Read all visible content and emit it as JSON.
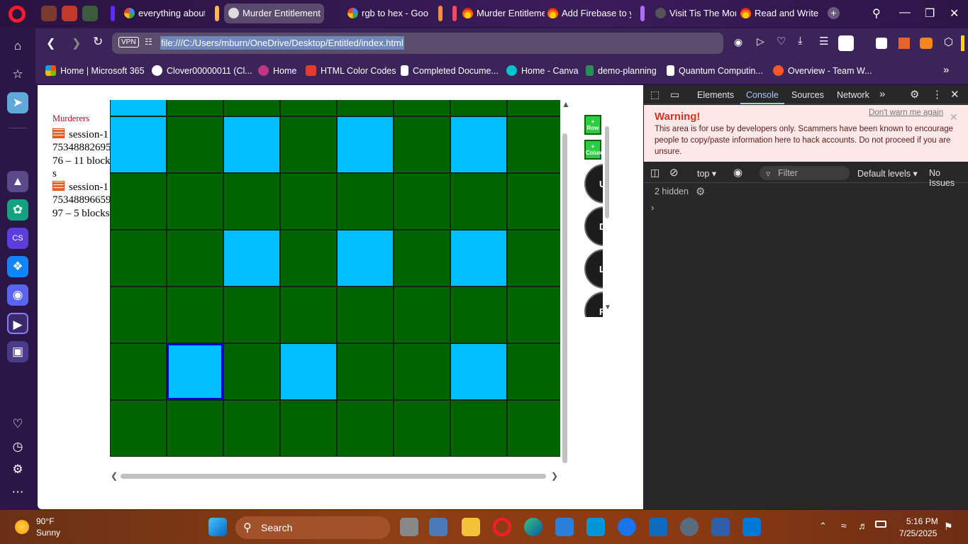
{
  "browser": {
    "tabs": [
      {
        "title": "everything about",
        "favicon": "google-icon"
      },
      {
        "title": "Murder Entitlement",
        "favicon": "globe-icon",
        "active": true
      },
      {
        "title": "rgb to hex - Goo",
        "favicon": "google-icon"
      },
      {
        "title": "Murder Entitleme",
        "favicon": "firebase-icon"
      },
      {
        "title": "Add Firebase to y",
        "favicon": "firebase-icon"
      },
      {
        "title": "Visit Tis The Mor",
        "favicon": "site-icon"
      },
      {
        "title": "Read and Write D",
        "favicon": "firebase-icon"
      }
    ],
    "vpn_label": "VPN",
    "url": "file:///C:/Users/mburn/OneDrive/Desktop/Entitled/index.html",
    "bookmarks": [
      {
        "label": "Home | Microsoft 365",
        "color": "#f25022"
      },
      {
        "label": "Clover00000011 (Cl...",
        "color": "#ffffff"
      },
      {
        "label": "Home",
        "color": "#c13584"
      },
      {
        "label": "HTML Color Codes",
        "color": "#e33b2e"
      },
      {
        "label": "Completed Docume...",
        "color": "#ffffff"
      },
      {
        "label": "Home - Canva",
        "color": "#00c4cc"
      },
      {
        "label": "demo-planning",
        "color": "#2e8b57"
      },
      {
        "label": "Quantum Computin...",
        "color": "#ffffff"
      },
      {
        "label": "Overview - Team W...",
        "color": "#ff5722"
      }
    ]
  },
  "app": {
    "murderers_title": "Murderers",
    "murderers": [
      {
        "text": "session-17534888269576 – 11 blocks"
      },
      {
        "text": "session-17534889665997 – 5 blocks"
      }
    ],
    "grid_columns": 8,
    "grid_rows": [
      [
        "b",
        "g",
        "g",
        "g",
        "g",
        "g",
        "g",
        "g"
      ],
      [
        "b",
        "g",
        "b",
        "g",
        "b",
        "g",
        "b",
        "g"
      ],
      [
        "g",
        "g",
        "g",
        "g",
        "g",
        "g",
        "g",
        "g"
      ],
      [
        "g",
        "g",
        "b",
        "g",
        "b",
        "g",
        "b",
        "g"
      ],
      [
        "g",
        "g",
        "g",
        "g",
        "g",
        "g",
        "g",
        "g"
      ],
      [
        "g",
        "b",
        "g",
        "b",
        "g",
        "g",
        "b",
        "g"
      ],
      [
        "g",
        "g",
        "g",
        "g",
        "g",
        "g",
        "g",
        "g"
      ]
    ],
    "selected_cell": {
      "row": 5,
      "col": 1
    },
    "colors": {
      "green": "#006400",
      "blue": "#00bfff",
      "selected_border": "#0000cd"
    },
    "add_row_label": "+ Row",
    "add_column_label": "+ Column",
    "direction_buttons": [
      "Up",
      "Down",
      "Left",
      "Right"
    ]
  },
  "devtools": {
    "tabs": [
      "Elements",
      "Console",
      "Sources",
      "Network"
    ],
    "active_tab": "Console",
    "warning_title": "Warning!",
    "warning_text": "This area is for use by developers only. Scammers have been known to encourage people to copy/paste information here to hack accounts. Do not proceed if you are unsure.",
    "dont_warn": "Don't warn me again",
    "context": "top",
    "filter_placeholder": "Filter",
    "levels": "Default levels",
    "issues": "No Issues",
    "hidden": "2 hidden"
  },
  "taskbar": {
    "temperature": "90°F",
    "condition": "Sunny",
    "search_placeholder": "Search",
    "time": "5:16 PM",
    "date": "7/25/2025"
  }
}
